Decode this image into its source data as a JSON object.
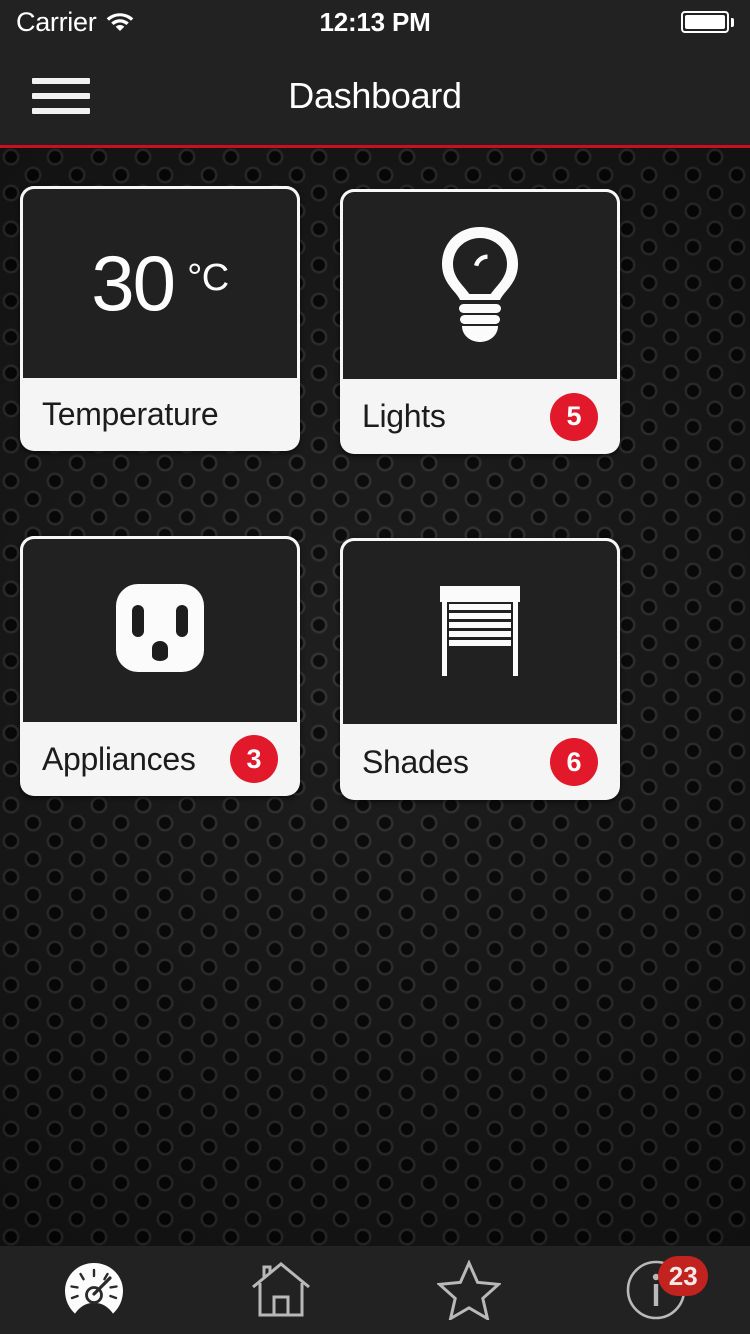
{
  "status_bar": {
    "carrier": "Carrier",
    "wifi_icon": "wifi-icon",
    "time": "12:13 PM",
    "battery_icon": "battery-full-icon"
  },
  "nav_bar": {
    "title": "Dashboard",
    "menu_icon": "hamburger-menu-icon",
    "accent_color": "#cc0e20",
    "background_color": "#222222"
  },
  "theme": {
    "badge_red": "#e2182b",
    "tile_dark": "#212121",
    "tile_footer": "#f5f5f5",
    "label_dark": "#1c1c1c"
  },
  "tiles": [
    {
      "id": "temperature",
      "label": "Temperature",
      "value": "30",
      "unit": "°C",
      "icon": "thermometer-reading",
      "badge": null
    },
    {
      "id": "lights",
      "label": "Lights",
      "icon": "lightbulb-icon",
      "badge": "5"
    },
    {
      "id": "appliances",
      "label": "Appliances",
      "icon": "power-outlet-icon",
      "badge": "3"
    },
    {
      "id": "shades",
      "label": "Shades",
      "icon": "window-shade-icon",
      "badge": "6"
    }
  ],
  "tab_bar": {
    "items": [
      {
        "id": "dashboard",
        "icon": "gauge-icon",
        "active": true,
        "badge": null
      },
      {
        "id": "home",
        "icon": "home-icon",
        "active": false,
        "badge": null
      },
      {
        "id": "favorites",
        "icon": "star-icon",
        "active": false,
        "badge": null
      },
      {
        "id": "info",
        "icon": "info-circle-icon",
        "active": false,
        "badge": "23"
      }
    ]
  }
}
